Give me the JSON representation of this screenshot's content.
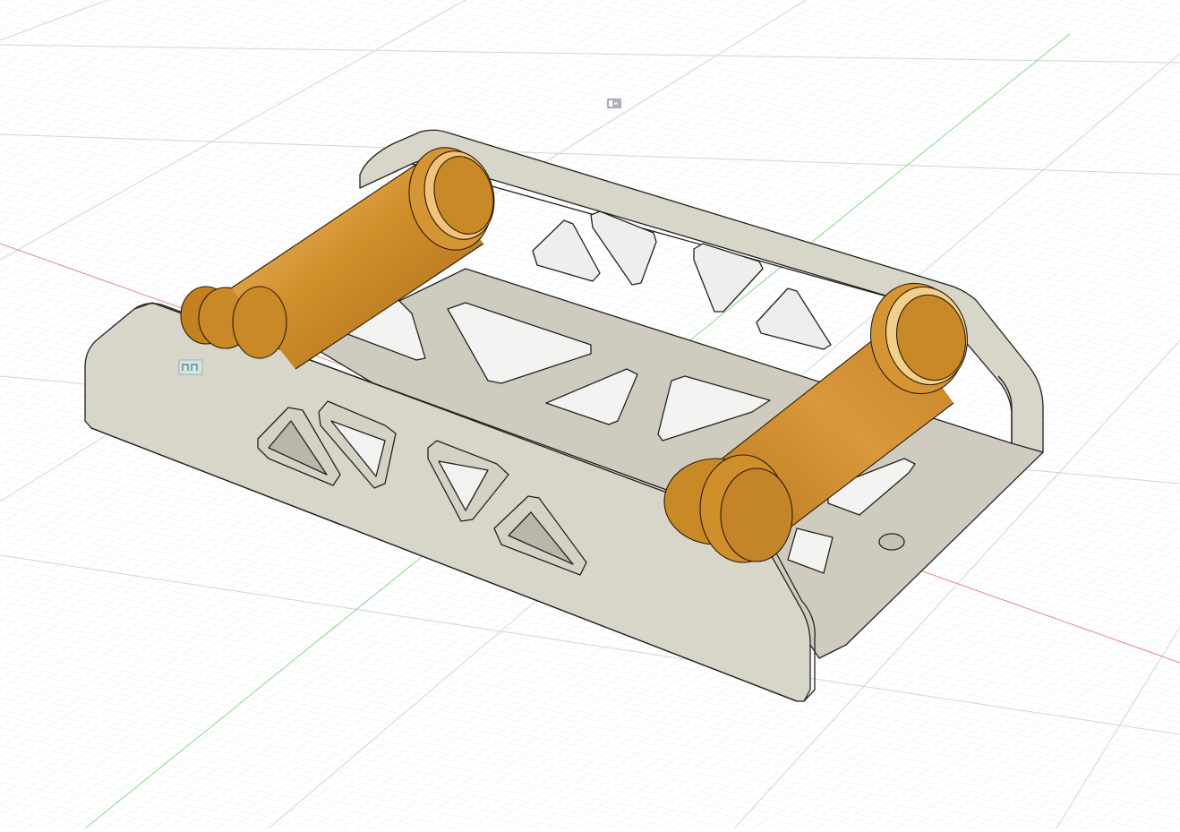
{
  "viewport": {
    "background": "#ffffff",
    "grid_minor_color": "#e4e6e8",
    "grid_major_color": "#cfd2d5",
    "x_axis_color": "#e58a8a",
    "y_axis_color": "#8ad88a"
  },
  "model": {
    "frame_color": "#d8d5c9",
    "frame_edge_color": "#222222",
    "roller_color": "#d18f2b",
    "roller_highlight": "#f4d39a",
    "roller_shadow": "#9e6416"
  },
  "overlays": {
    "construction_glyph_icon": "sketch-origin-icon",
    "joint_glyph_icon": "rigid-joint-icon"
  }
}
